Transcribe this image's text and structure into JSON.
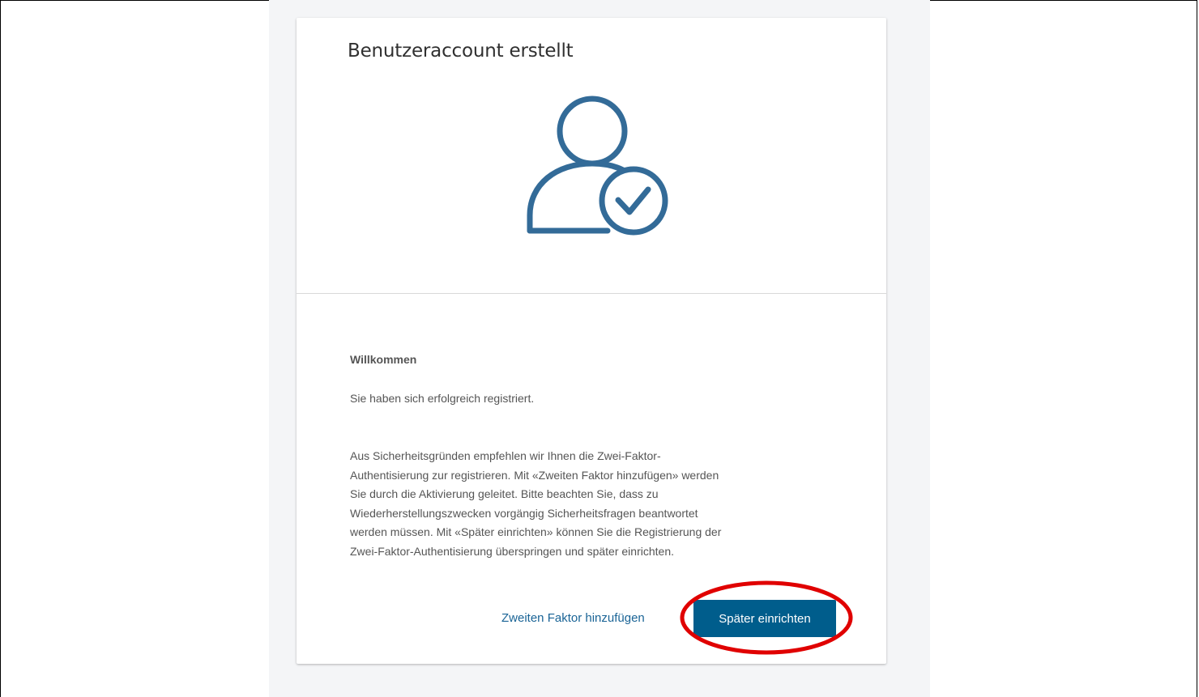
{
  "card": {
    "title": "Benutzeraccount erstellt",
    "icon": "user-check-icon",
    "welcome": "Willkommen",
    "success_message": "Sie haben sich erfolgreich registriert.",
    "info_lines": [
      "Aus Sicherheitsgründen empfehlen wir Ihnen die Zwei-Faktor-",
      "Authentisierung zur registrieren. Mit «Zweiten Faktor hinzufügen» werden",
      "Sie durch die Aktivierung geleitet. Bitte beachten Sie, dass zu",
      "Wiederherstellungszwecken vorgängig Sicherheitsfragen beantwortet",
      "werden müssen. Mit «Später einrichten» können Sie die Registrierung der",
      "Zwei-Faktor-Authentisierung überspringen und später einrichten."
    ]
  },
  "actions": {
    "add_second_factor_label": "Zweiten Faktor hinzufügen",
    "setup_later_label": "Später einrichten"
  },
  "colors": {
    "icon_stroke": "#336b98",
    "primary_button": "#005d8c",
    "link": "#1a6496",
    "highlight_ring": "#e00000"
  }
}
